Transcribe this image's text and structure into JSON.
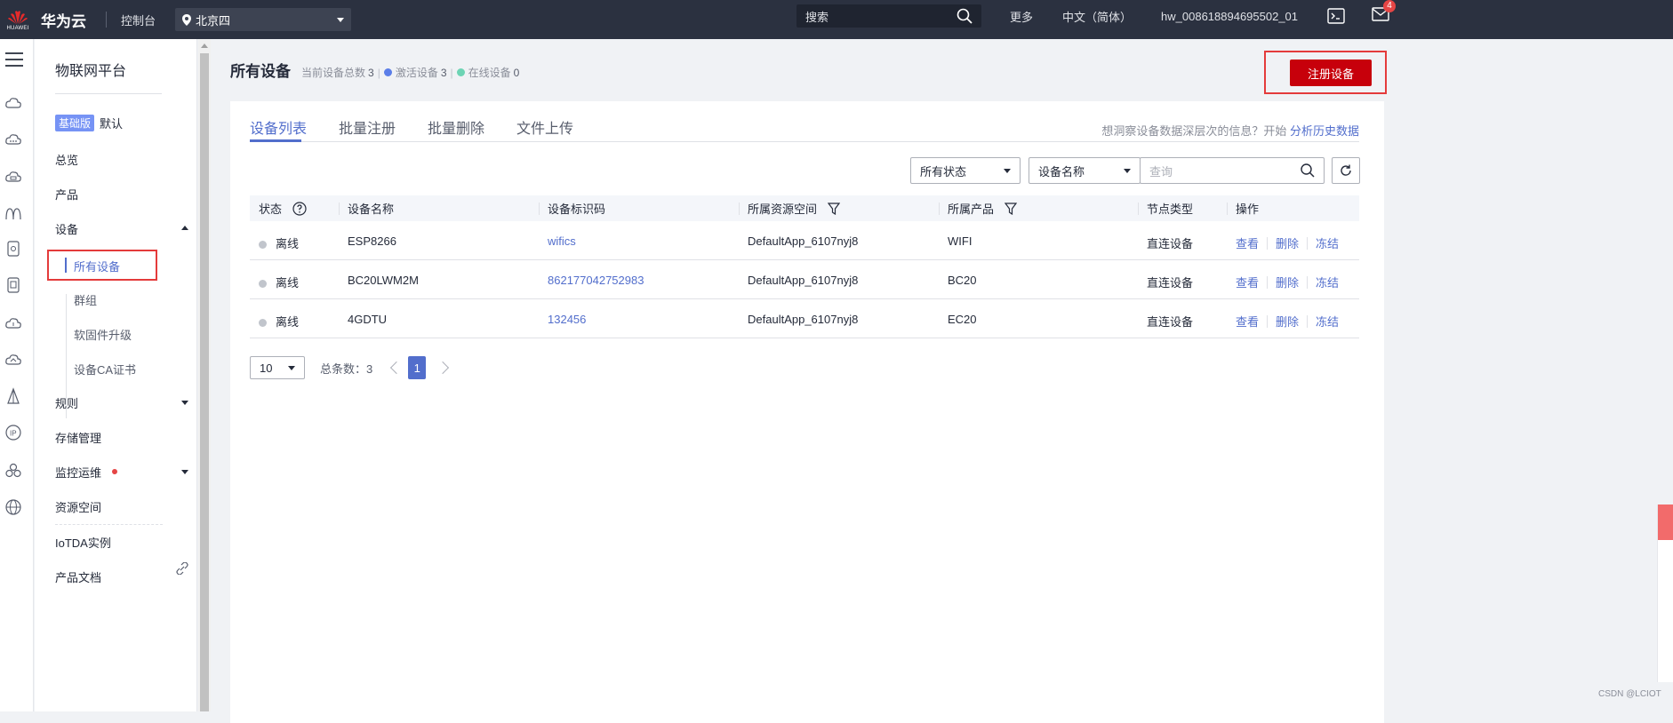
{
  "topbar": {
    "logo_text": "HUAWEI",
    "brand": "华为云",
    "console": "控制台",
    "region": "北京四",
    "search_placeholder": "搜索",
    "more": "更多",
    "language": "中文（简体）",
    "user": "hw_008618894695502_01",
    "mail_count": "4"
  },
  "sidebar": {
    "title": "物联网平台",
    "edition_tag": "基础版",
    "edition_label": "默认",
    "items": {
      "overview": "总览",
      "product": "产品",
      "device": "设备",
      "all_devices": "所有设备",
      "group": "群组",
      "firmware": "软固件升级",
      "ca_cert": "设备CA证书",
      "rules": "规则",
      "storage": "存储管理",
      "monitor": "监控运维",
      "resource_space": "资源空间",
      "iotda_instance": "IoTDA实例",
      "product_docs": "产品文档"
    }
  },
  "main": {
    "page_title": "所有设备",
    "stats": {
      "total_label": "当前设备总数",
      "total_value": "3",
      "active_label": "激活设备",
      "active_value": "3",
      "online_label": "在线设备",
      "online_value": "0"
    },
    "register_button": "注册设备",
    "tabs": [
      "设备列表",
      "批量注册",
      "批量删除",
      "文件上传"
    ],
    "insight_text": "想洞察设备数据深层次的信息？开始",
    "insight_link": "分析历史数据",
    "filters": {
      "status": "所有状态",
      "field": "设备名称",
      "query_placeholder": "查询"
    },
    "table": {
      "headers": [
        "状态",
        "设备名称",
        "设备标识码",
        "所属资源空间",
        "所属产品",
        "节点类型",
        "操作"
      ],
      "rows": [
        {
          "status": "离线",
          "name": "ESP8266",
          "id": "wifics",
          "space": "DefaultApp_6107nyj8",
          "product": "WIFI",
          "node": "直连设备"
        },
        {
          "status": "离线",
          "name": "BC20LWM2M",
          "id": "862177042752983",
          "space": "DefaultApp_6107nyj8",
          "product": "BC20",
          "node": "直连设备"
        },
        {
          "status": "离线",
          "name": "4GDTU",
          "id": "132456",
          "space": "DefaultApp_6107nyj8",
          "product": "EC20",
          "node": "直连设备"
        }
      ],
      "actions": [
        "查看",
        "删除",
        "冻结"
      ]
    },
    "pager": {
      "page_size": "10",
      "total_text": "总条数：3",
      "current_page": "1"
    }
  },
  "watermark": "CSDN @LCIOT",
  "colors": {
    "topbar": "#2b3140",
    "accent": "#526ecc",
    "primary_button": "#c7000b",
    "highlight_border": "#e43b3b",
    "active_dot": "#5b7ee8",
    "online_dot": "#6dd4b4",
    "offline_dot": "#c1c5cc"
  }
}
